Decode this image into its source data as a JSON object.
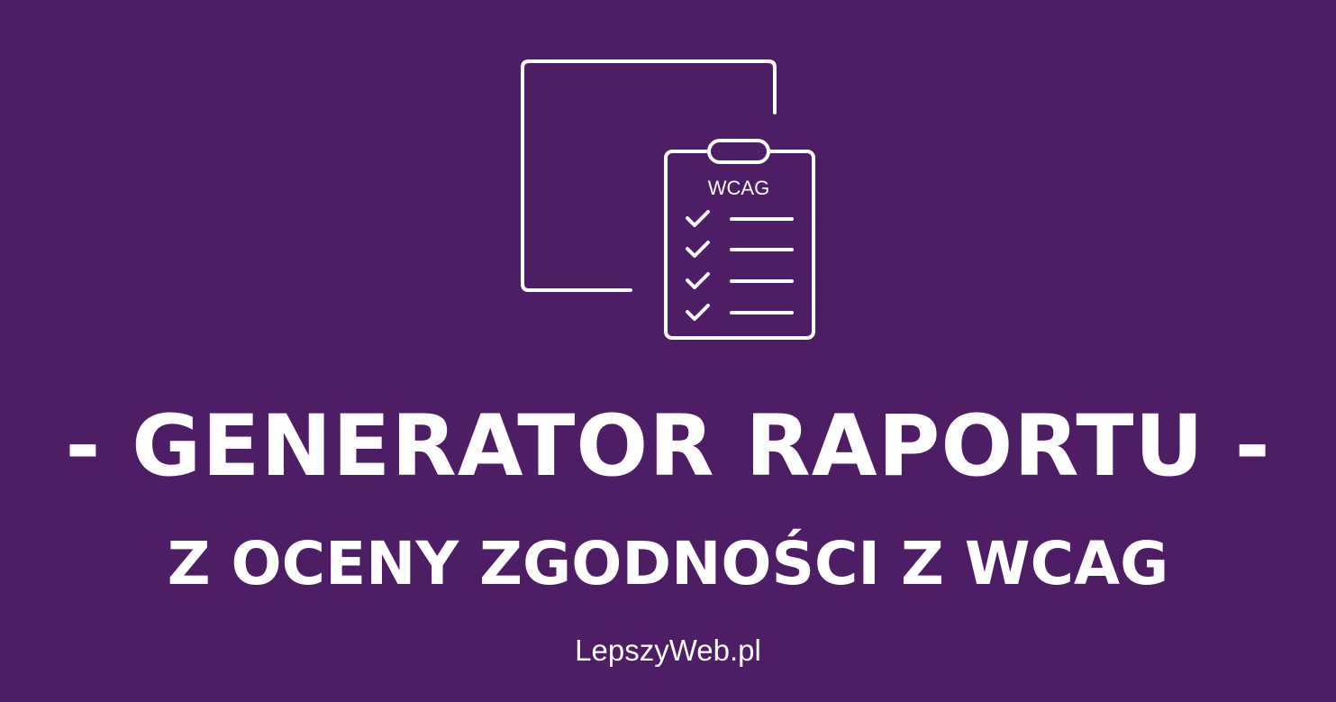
{
  "illustration": {
    "icon": "report-clipboard-icon",
    "clipboard_label": "WCAG",
    "checklist_items": 4,
    "stroke_color": "#ffffff"
  },
  "header": {
    "title": "- GENERATOR RAPORTU -",
    "subtitle": "Z OCENY ZGODNOŚCI Z WCAG"
  },
  "footer": {
    "site": "LepszyWeb.pl"
  },
  "colors": {
    "background": "#4f1c66",
    "text": "#ffffff"
  }
}
